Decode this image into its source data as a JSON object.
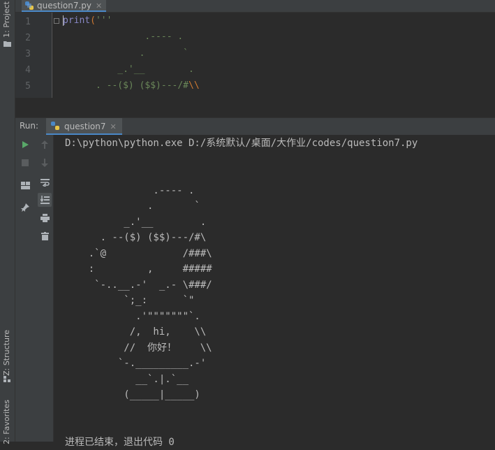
{
  "left_strip": {
    "project_tab": "1: Project",
    "structure_tab": "Z: Structure",
    "favorites_tab": "2: Favorites"
  },
  "editor": {
    "tab_label": "question7.py",
    "line_numbers": [
      "1",
      "2",
      "3",
      "4",
      "5"
    ],
    "lines": [
      {
        "kw": "print",
        "paren": "(",
        "str": "'''",
        "esc": ""
      },
      {
        "kw": "",
        "paren": "",
        "str": "               .---- .",
        "esc": ""
      },
      {
        "kw": "",
        "paren": "",
        "str": "              .       `",
        "esc": ""
      },
      {
        "kw": "",
        "paren": "",
        "str": "          _.'__        .",
        "esc": ""
      },
      {
        "kw": "",
        "paren": "",
        "str": "      . --($) ($$)---/#",
        "esc": "\\\\"
      }
    ]
  },
  "run": {
    "label": "Run:",
    "tab_label": "question7",
    "command": "D:\\python\\python.exe D:/系统默认/桌面/大作业/codes/question7.py",
    "output_lines": [
      "",
      "",
      "               .---- .",
      "              .       `",
      "          _.'__        .",
      "      . --($) ($$)---/#\\",
      "    .`@             /###\\",
      "    :         ,     #####",
      "     `-..__.-'  _.- \\###/",
      "          `;_:      `\"",
      "            .'\"\"\"\"\"\"\"`.",
      "           /,  hi,    \\\\",
      "          //  你好！    \\\\",
      "         `-._________.-'",
      "            __`.|.`__",
      "          (_____|_____)",
      "",
      "",
      "进程已结束，退出代码 0"
    ]
  }
}
